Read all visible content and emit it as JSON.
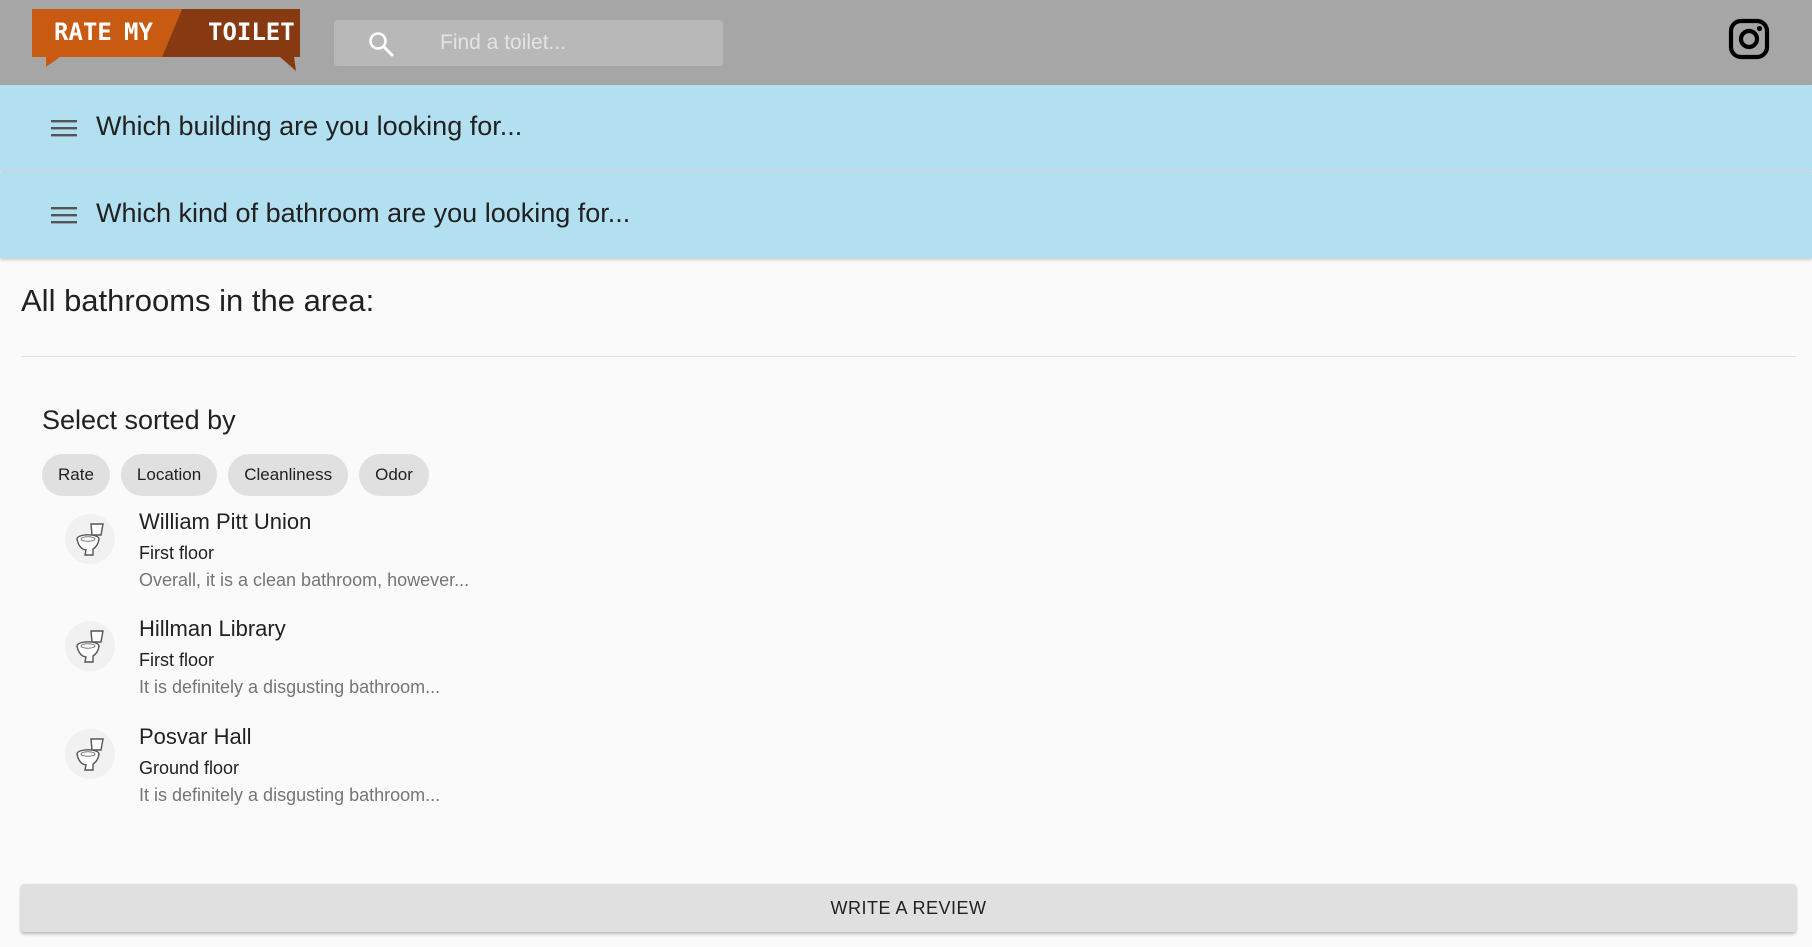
{
  "header": {
    "logo_words": [
      "RATE",
      "MY",
      "TOILET"
    ],
    "search_placeholder": "Find a toilet...",
    "search_icon": "search-icon",
    "social_icon": "instagram-icon",
    "colors": {
      "background": "#a6a6a6",
      "logo_orange": "#c95a12",
      "logo_brown": "#873a12"
    }
  },
  "filters": [
    {
      "label": "Which building are you looking for...",
      "icon": "menu-icon"
    },
    {
      "label": "Which kind of bathroom are you looking for...",
      "icon": "menu-icon"
    }
  ],
  "main": {
    "heading": "All bathrooms in the area:",
    "sort_title": "Select sorted by",
    "sort_chips": [
      "Rate",
      "Location",
      "Cleanliness",
      "Odor"
    ],
    "bathrooms": [
      {
        "name": "William Pitt Union",
        "floor": "First floor",
        "review": "Overall, it is a clean bathroom, however...",
        "icon": "toilet-icon"
      },
      {
        "name": "Hillman Library",
        "floor": "First floor",
        "review": "It is definitely a disgusting bathroom...",
        "icon": "toilet-icon"
      },
      {
        "name": "Posvar Hall",
        "floor": "Ground floor",
        "review": "It is definitely a disgusting bathroom...",
        "icon": "toilet-icon"
      }
    ],
    "write_review_label": "WRITE A REVIEW"
  },
  "colors": {
    "accordion_bg": "#b3e0f0",
    "page_bg": "#fafafa",
    "chip_bg": "#e0e0e0"
  }
}
